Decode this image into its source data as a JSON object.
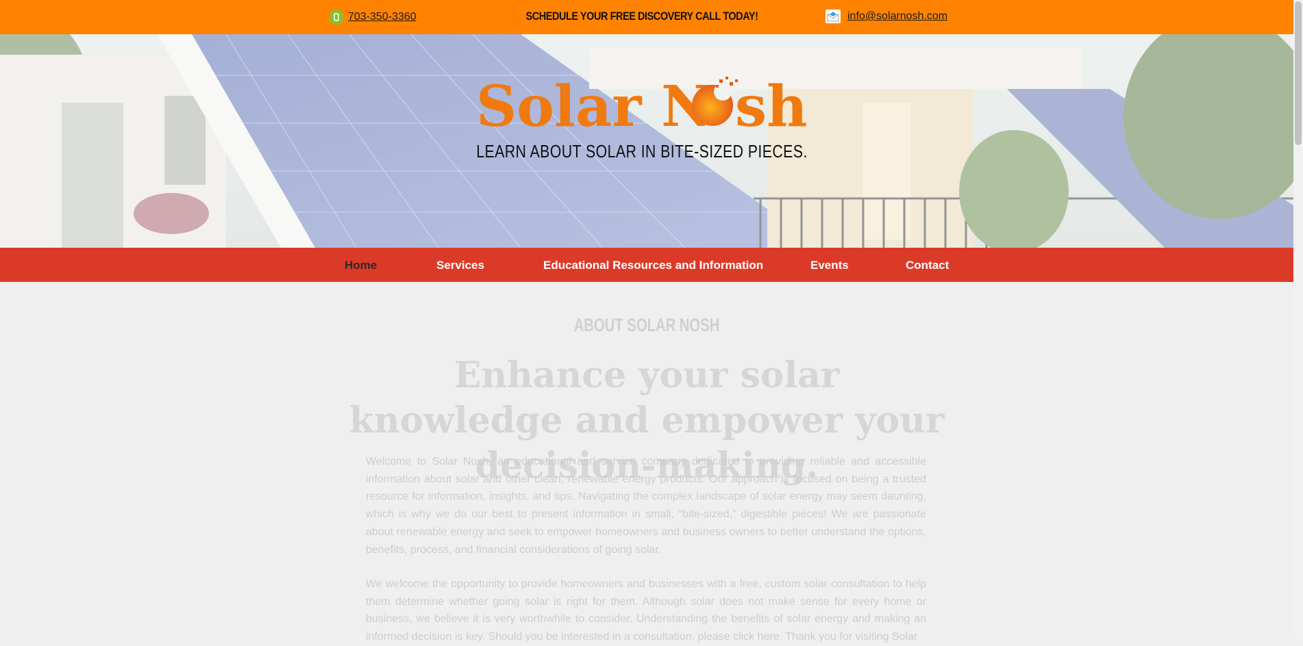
{
  "topbar": {
    "phone": "703-350-3360",
    "cta": "SCHEDULE YOUR FREE DISCOVERY CALL TODAY!",
    "email": "info@solarnosh.com",
    "phone_icon": "phone-icon",
    "email_icon": "email-icon"
  },
  "hero": {
    "logo_text": "Solar Nosh",
    "tagline": "LEARN ABOUT SOLAR IN BITE-SIZED PIECES."
  },
  "nav": {
    "items": [
      "Home",
      "Services",
      "Educational Resources and Information",
      "Events",
      "Contact"
    ],
    "active": "Home"
  },
  "content": {
    "eyebrow": "ABOUT SOLAR NOSH",
    "headline": "Enhance your solar knowledge and empower your decision-making.",
    "paragraph1": "Welcome to Solar Nosh, an educational and service company dedicated to providing reliable and accessible information about solar and other clean, renewable energy products. Our approach is focused on being a trusted resource for information, insights, and tips. Navigating the complex landscape of solar energy may seem daunting, which is why we do our best to present information in small, “bite-sized,” digestible pieces! We are passionate about renewable energy and seek to empower homeowners and business owners to better understand the options, benefits, process, and financial considerations of going solar.",
    "paragraph2": "We welcome the opportunity to provide homeowners and businesses with a free, custom solar consultation to help them determine whether going solar is right for them. Although solar does not make sense for every home or business, we believe it is very worthwhile to consider. Understanding the benefits of solar energy and making an informed decision is key. Should you be interested in a consultation, please click here. Thank you for visiting Solar"
  },
  "colors": {
    "topbar": "#ff8300",
    "nav": "#dc3a29",
    "logo_orange": "#f07a10"
  }
}
